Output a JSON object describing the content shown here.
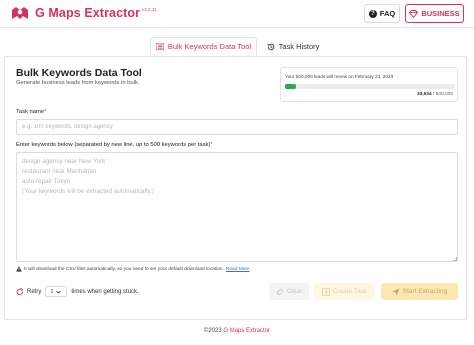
{
  "app": {
    "name": "G Maps Extractor",
    "version": "v2.2.11",
    "brand_color": "#d6325f"
  },
  "header": {
    "faq_label": "FAQ",
    "business_label": "BUSINESS"
  },
  "tabs": [
    {
      "label": "Bulk Keywords Data Tool",
      "icon": "list-icon",
      "active": true
    },
    {
      "label": "Task History",
      "icon": "history-icon",
      "active": false
    }
  ],
  "main": {
    "title": "Bulk Keywords Data Tool",
    "subtitle": "Generate business leads from keywords in bulk."
  },
  "license": {
    "renew_text": "Your 500,000 leads will renew on February 23, 2023",
    "used": "33,534",
    "total": "/ 500,000",
    "progress_fraction": 0.067,
    "bar_color": "#2eaa4f"
  },
  "form": {
    "task_name_label": "Task name",
    "task_name_placeholder": "e.g. 100 keywords, design agency",
    "task_name_value": "",
    "required_mark": "*",
    "keywords_label": "Enter keywords below (separated by new line, up to 500 keywords per task)",
    "keywords_placeholder": "design agency near New York\nrestaurant near Manhattan\nauto repair Tokyo\n(Your keywords will be extracted automatically.)",
    "keywords_value": "",
    "download_note": "It will download the CSV files automatically, so you need to set your default download location.",
    "read_more": "Read More"
  },
  "retry": {
    "label": "Retry",
    "value": "1",
    "suffix": "times when getting stuck."
  },
  "actions": {
    "clear_label": "Clear",
    "create_label": "Create Task",
    "start_label": "Start Extracting"
  },
  "footer": {
    "copyright": "©2023",
    "link": "G Maps Extractor"
  }
}
